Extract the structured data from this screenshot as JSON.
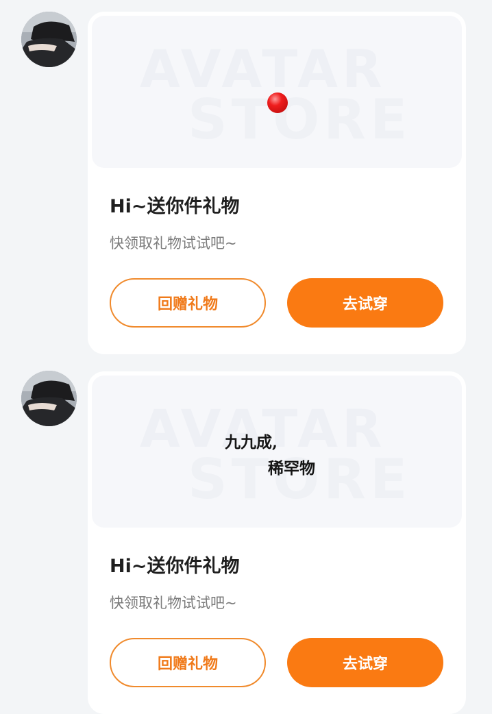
{
  "watermark": {
    "line1": "AVATAR",
    "line2": "STORE"
  },
  "messages": [
    {
      "title": "Hi~送你件礼物",
      "subtitle": "快领取礼物试试吧~",
      "return_gift_label": "回赠礼物",
      "try_on_label": "去试穿"
    },
    {
      "title": "Hi~送你件礼物",
      "subtitle": "快领取礼物试试吧~",
      "return_gift_label": "回赠礼物",
      "try_on_label": "去试穿",
      "gift_text_line1": "九九成,",
      "gift_text_line2": "稀罕物"
    }
  ],
  "colors": {
    "accent": "#fa7a12",
    "background": "#f3f5f7"
  }
}
